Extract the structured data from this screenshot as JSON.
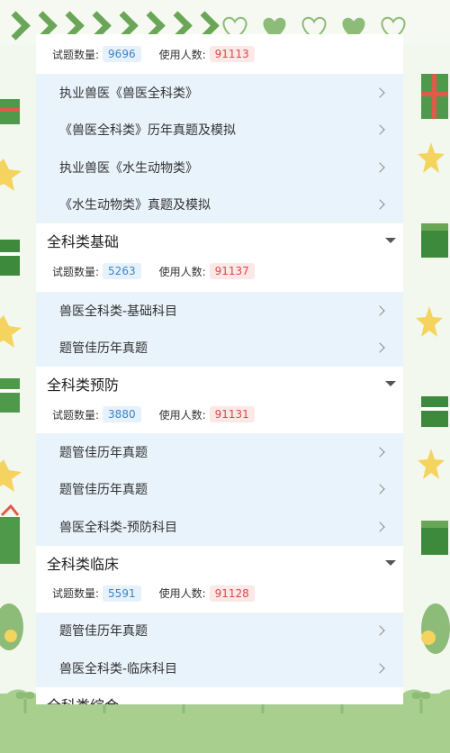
{
  "sections": [
    {
      "title": "",
      "stats": {
        "count_label": "试题数量:",
        "count": "9696",
        "users_label": "使用人数:",
        "users": "91113"
      },
      "items": [
        "执业兽医《兽医全科类》",
        "《兽医全科类》历年真题及模拟",
        "执业兽医《水生动物类》",
        "《水生动物类》真题及模拟"
      ]
    },
    {
      "title": "全科类基础",
      "stats": {
        "count_label": "试题数量:",
        "count": "5263",
        "users_label": "使用人数:",
        "users": "91137"
      },
      "items": [
        "兽医全科类-基础科目",
        "题管佳历年真题"
      ]
    },
    {
      "title": "全科类预防",
      "stats": {
        "count_label": "试题数量:",
        "count": "3880",
        "users_label": "使用人数:",
        "users": "91131"
      },
      "items": [
        "题管佳历年真题",
        "题管佳历年真题",
        "兽医全科类-预防科目"
      ]
    },
    {
      "title": "全科类临床",
      "stats": {
        "count_label": "试题数量:",
        "count": "5591",
        "users_label": "使用人数:",
        "users": "91128"
      },
      "items": [
        "题管佳历年真题",
        "兽医全科类-临床科目"
      ]
    },
    {
      "title": "全科类综合"
    }
  ],
  "colors": {
    "accent_green": "#6aa657",
    "list_bg": "#e9f3fc",
    "count_blue": "#3a86c8",
    "users_red": "#d54b4b"
  }
}
